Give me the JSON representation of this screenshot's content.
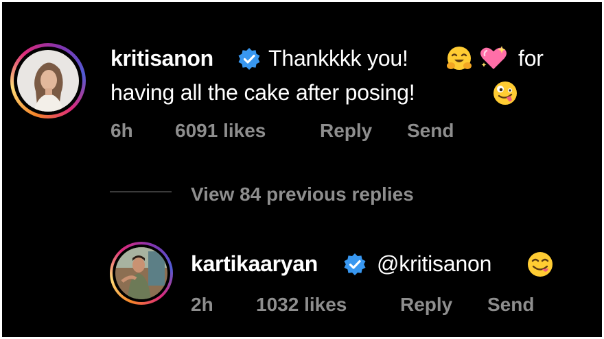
{
  "comment": {
    "username": "kritisanon",
    "text_line1": "Thankkkk you!",
    "text_line1_end": "for",
    "text_line2": "having all the cake after posing!",
    "emojis": [
      "hugging-face-emoji",
      "sparkling-heart-emoji",
      "zany-face-emoji"
    ],
    "time": "6h",
    "likes": "6091 likes",
    "reply_label": "Reply",
    "send_label": "Send"
  },
  "thread": {
    "view_replies_label": "View 84 previous replies"
  },
  "reply": {
    "username": "kartikaaryan",
    "text": "@kritisanon",
    "emojis": [
      "savoring-food-emoji"
    ],
    "time": "2h",
    "likes": "1032 likes",
    "reply_label": "Reply",
    "send_label": "Send"
  },
  "colors": {
    "background": "#000000",
    "text_primary": "#ffffff",
    "text_secondary": "#8e8e8e",
    "verified_badge": "#3897f0"
  }
}
